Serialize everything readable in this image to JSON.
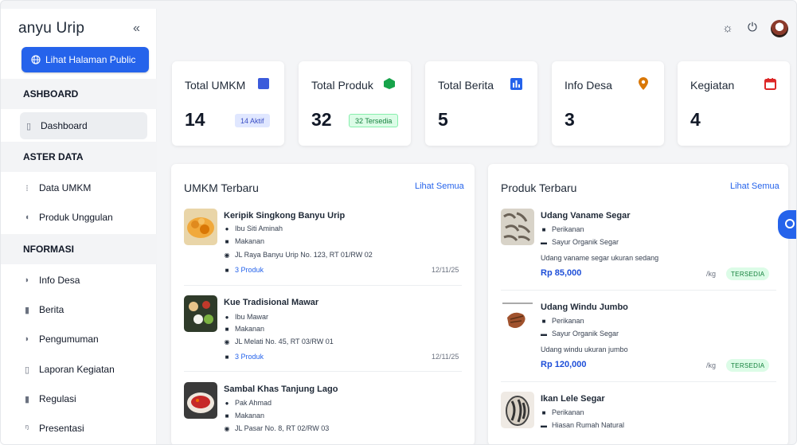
{
  "sidebar": {
    "brand": "anyu Urip",
    "collapse_icon": "«",
    "public_button": "Lihat Halaman Public",
    "sections": {
      "dashboard": "ASHBOARD",
      "master": "ASTER DATA",
      "informasi": "NFORMASI"
    },
    "items": {
      "dashboard": "Dashboard",
      "data_umkm": "Data UMKM",
      "produk_unggulan": "Produk Unggulan",
      "info_desa": "Info Desa",
      "berita": "Berita",
      "pengumuman": "Pengumuman",
      "laporan": "Laporan Kegiatan",
      "regulasi": "Regulasi",
      "presentasi": "Presentasi"
    }
  },
  "topbar": {
    "icons": [
      "sun-icon",
      "power-icon",
      "user-avatar"
    ]
  },
  "stats": {
    "umkm": {
      "label": "Total UMKM",
      "value": "14",
      "badge": "14 Aktif",
      "color": "#3b5bdb"
    },
    "produk": {
      "label": "Total Produk",
      "value": "32",
      "badge": "32 Tersedia",
      "color": "#16a34a"
    },
    "berita": {
      "label": "Total Berita",
      "value": "5",
      "color": "#2563eb"
    },
    "info": {
      "label": "Info Desa",
      "value": "3",
      "color": "#d97706"
    },
    "kegiatan": {
      "label": "Kegiatan",
      "value": "4",
      "color": "#dc2626"
    }
  },
  "umkm_panel": {
    "title": "UMKM Terbaru",
    "see_all": "Lihat Semua",
    "items": [
      {
        "name": "Keripik Singkong Banyu Urip",
        "owner": "Ibu Siti Aminah",
        "category": "Makanan",
        "address": "JL Raya Banyu Urip No. 123, RT 01/RW 02",
        "products": "3 Produk",
        "date": "12/11/25"
      },
      {
        "name": "Kue Tradisional Mawar",
        "owner": "Ibu Mawar",
        "category": "Makanan",
        "address": "JL Melati No. 45, RT 03/RW 01",
        "products": "3 Produk",
        "date": "12/11/25"
      },
      {
        "name": "Sambal Khas Tanjung Lago",
        "owner": "Pak Ahmad",
        "category": "Makanan",
        "address": "JL Pasar No. 8, RT 02/RW 03"
      }
    ]
  },
  "produk_panel": {
    "title": "Produk Terbaru",
    "see_all": "Lihat Semua",
    "items": [
      {
        "name": "Udang Vaname Segar",
        "category": "Perikanan",
        "umkm": "Sayur Organik Segar",
        "desc": "Udang vaname segar ukuran sedang",
        "price": "Rp 85,000",
        "unit": "/kg",
        "status": "TERSEDIA"
      },
      {
        "name": "Udang Windu Jumbo",
        "category": "Perikanan",
        "umkm": "Sayur Organik Segar",
        "desc": "Udang windu ukuran jumbo",
        "price": "Rp 120,000",
        "unit": "/kg",
        "status": "TERSEDIA"
      },
      {
        "name": "Ikan Lele Segar",
        "category": "Perikanan",
        "umkm": "Hiasan Rumah Natural"
      }
    ]
  }
}
